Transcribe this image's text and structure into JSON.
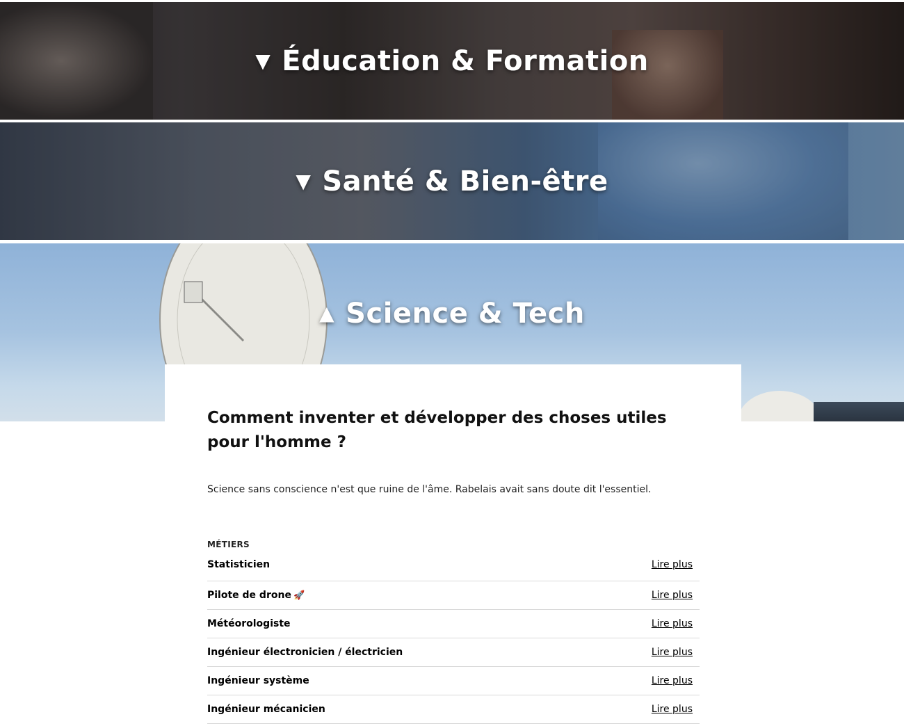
{
  "categories": [
    {
      "title": "Éducation & Formation",
      "toggle_icon": "▼",
      "state": "collapsed"
    },
    {
      "title": "Santé & Bien-être",
      "toggle_icon": "▼",
      "state": "collapsed"
    },
    {
      "title": "Science & Tech",
      "toggle_icon": "▲",
      "state": "expanded"
    }
  ],
  "panel": {
    "heading": "Comment inventer et développer des choses utiles pour l'homme ?",
    "intro": "Science sans conscience n'est que ruine de l'âme. Rabelais avait sans doute dit l'essentiel.",
    "section_label": "MÉTIERS",
    "link_label": "Lire plus",
    "jobs": [
      {
        "name": "Statisticien",
        "emoji": ""
      },
      {
        "name": "Pilote de drone",
        "emoji": "🚀"
      },
      {
        "name": "Météorologiste",
        "emoji": ""
      },
      {
        "name": "Ingénieur électronicien / électricien",
        "emoji": ""
      },
      {
        "name": "Ingénieur système",
        "emoji": ""
      },
      {
        "name": "Ingénieur mécanicien",
        "emoji": ""
      }
    ]
  },
  "colors": {
    "accent_rocket": "#e03a6e",
    "divider": "#d9d9d9"
  }
}
